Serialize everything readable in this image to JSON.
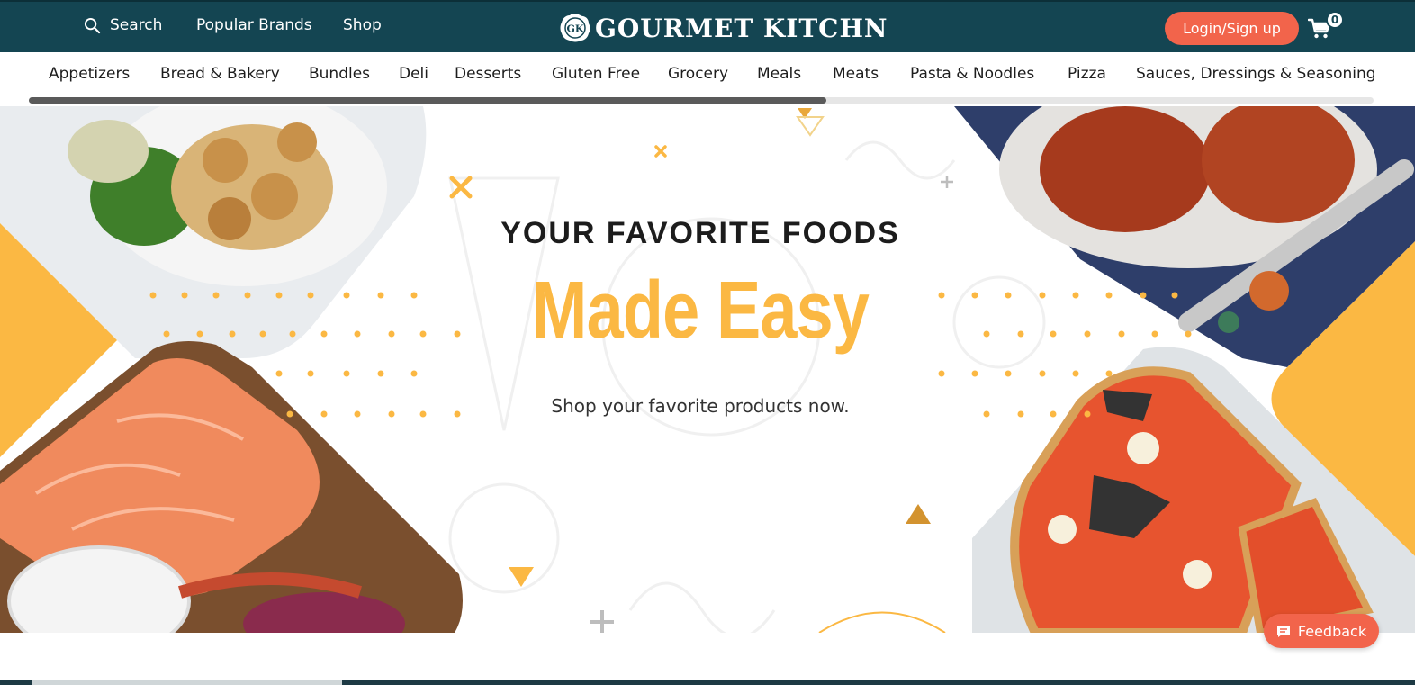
{
  "header": {
    "search_label": "Search",
    "popular_brands_label": "Popular Brands",
    "shop_label": "Shop",
    "logo_badge": "GK",
    "logo_text": "GOURMET KITCHN",
    "login_label": "Login/Sign up",
    "cart_count": "0",
    "bg_color": "#144552",
    "accent_color": "#f2644b"
  },
  "categories": [
    "Appetizers",
    "Bread & Bakery",
    "Bundles",
    "Deli",
    "Desserts",
    "Gluten Free",
    "Grocery",
    "Meals",
    "Meats",
    "Pasta & Noodles",
    "Pizza",
    "Sauces, Dressings & Seasonings"
  ],
  "hero": {
    "eyebrow": "YOUR FAVORITE FOODS",
    "title": "Made Easy",
    "subtitle": "Shop your favorite products now.",
    "title_color": "#fbb843"
  },
  "feedback": {
    "label": "Feedback"
  },
  "icons": {
    "search": "search-icon",
    "cart": "cart-icon",
    "feedback": "chat-bubble-icon"
  }
}
